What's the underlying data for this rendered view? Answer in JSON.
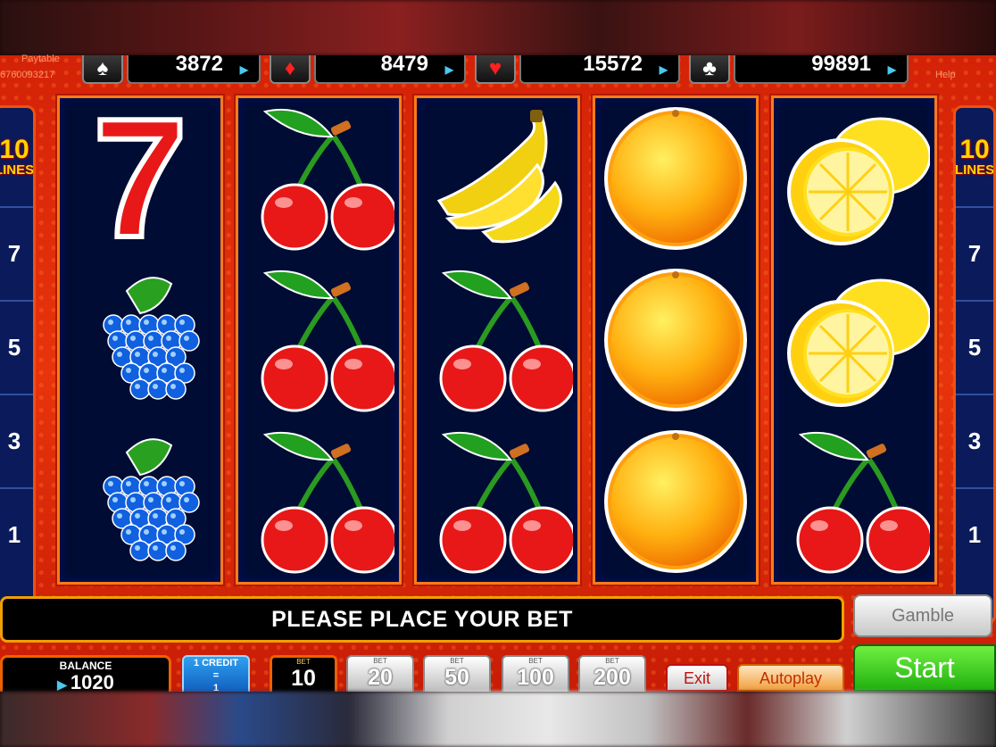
{
  "jackpots": [
    {
      "suit": "♠",
      "suit_name": "spade-icon",
      "value": "3872",
      "color": "#ffffff"
    },
    {
      "suit": "♦",
      "suit_name": "diamond-icon",
      "value": "8479",
      "color": "#ff2020"
    },
    {
      "suit": "♥",
      "suit_name": "heart-icon",
      "value": "15572",
      "color": "#ff2020"
    },
    {
      "suit": "♣",
      "suit_name": "club-icon",
      "value": "99891",
      "color": "#ffffff"
    }
  ],
  "corner": {
    "left_top": "Paytable",
    "left_bottom": "6760093217",
    "right": "Help"
  },
  "lines": {
    "count": "10",
    "label": "LINES",
    "numbers_left": [
      "7",
      "5",
      "3",
      "1"
    ],
    "numbers_right": [
      "7",
      "5",
      "3",
      "1"
    ]
  },
  "reels": [
    [
      "seven",
      "grapes",
      "grapes"
    ],
    [
      "cherry",
      "cherry",
      "cherry"
    ],
    [
      "banana",
      "cherry",
      "cherry"
    ],
    [
      "orange",
      "orange",
      "orange"
    ],
    [
      "lemon",
      "lemon",
      "cherry"
    ]
  ],
  "message": "PLEASE PLACE YOUR BET",
  "gamble_label": "Gamble",
  "start_label": "Start",
  "balance": {
    "label": "BALANCE",
    "value": "1020"
  },
  "credit": {
    "label": "1 CREDIT",
    "eq": "=",
    "value": "1"
  },
  "bet": {
    "label": "BET",
    "current": "10",
    "options": [
      "20",
      "50",
      "100",
      "200"
    ]
  },
  "exit_label": "Exit",
  "autoplay_label": "Autoplay",
  "colors": {
    "frame": "#e8340c",
    "reel_bg": "#000c34",
    "start": "#20b010"
  }
}
